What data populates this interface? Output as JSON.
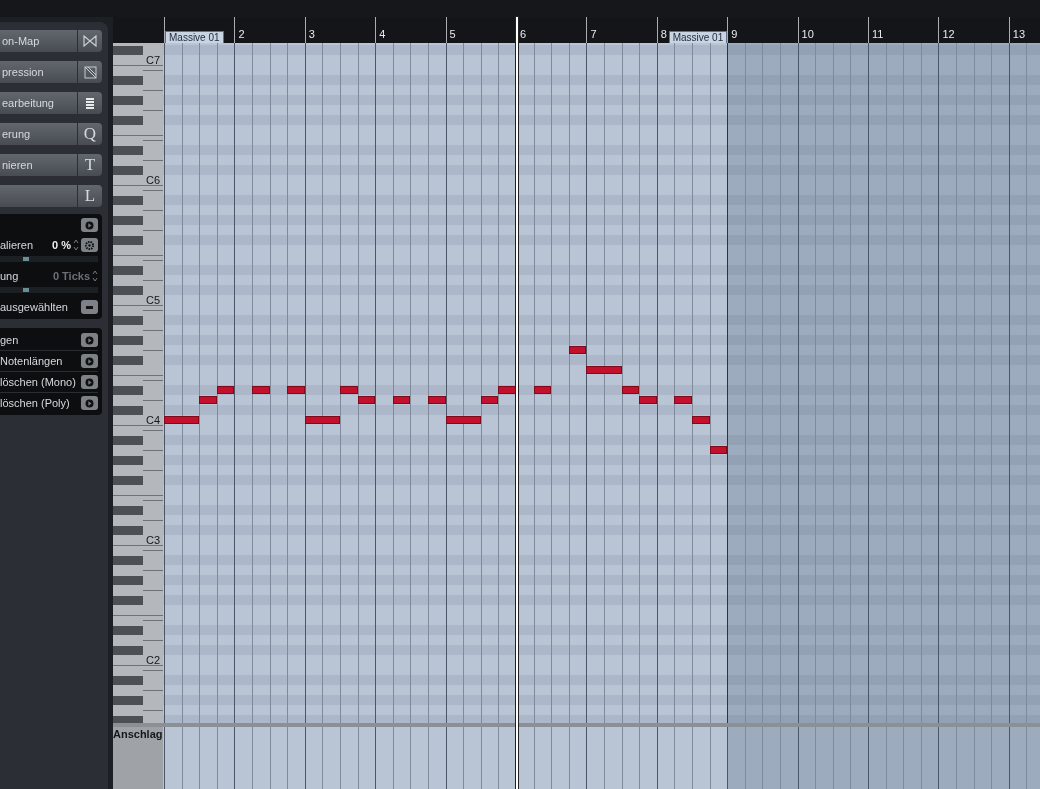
{
  "left_panel": {
    "buttons": [
      {
        "label": "on-Map",
        "kind": "bowtie"
      },
      {
        "label": "pression",
        "kind": "crossed-square"
      },
      {
        "label": "earbeitung",
        "kind": "list"
      },
      {
        "label": "erung",
        "kind": "glyph",
        "glyph": "Q"
      },
      {
        "label": "nieren",
        "kind": "glyph",
        "glyph": "T"
      },
      {
        "kind": "glyph",
        "glyph": "L"
      }
    ],
    "quantize_rows": [
      {
        "kind": "action"
      },
      {
        "kind": "value-reset",
        "label": "alieren",
        "value": "0 %",
        "disabled": false
      },
      {
        "kind": "slider",
        "level": 0.27
      },
      {
        "kind": "value",
        "label": "ung",
        "value": "0 Ticks",
        "disabled": true
      },
      {
        "kind": "slider",
        "level": 0.27
      },
      {
        "kind": "minus",
        "label": "ausgewählten"
      }
    ],
    "functions": [
      "gen",
      "Notenlängen",
      "löschen (Mono)",
      "löschen (Poly)"
    ]
  },
  "ruler": {
    "bars": [
      "2",
      "3",
      "4",
      "5",
      "6",
      "7",
      "8",
      "9",
      "10",
      "11",
      "12",
      "13"
    ],
    "part_labels": [
      "Massive 01",
      "Massive 01"
    ]
  },
  "keyboard": {
    "octave_labels": [
      "C7",
      "C6",
      "C5",
      "C4",
      "C3",
      "C2"
    ],
    "lane_label": "Anschlag"
  }
}
